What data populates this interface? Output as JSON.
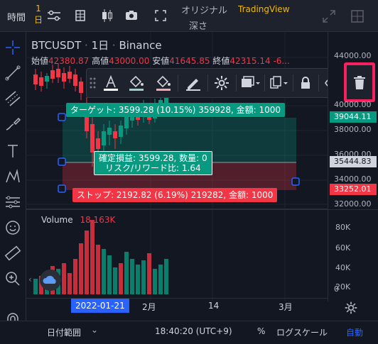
{
  "topbar": {
    "time_label": "時間",
    "interval_label": "1\n日",
    "interval_top": "1",
    "interval_bottom": "日",
    "original_label": "オリジナル",
    "tradingview_label": "TradingView",
    "depth_label": "深さ"
  },
  "chart": {
    "symbol": "BTCUSDT",
    "interval": "1日",
    "exchange": "Binance",
    "open_label": "始値",
    "open_value": "42380.87",
    "high_label": "高値",
    "high_value": "43000.00",
    "low_label": "安値",
    "low_value": "41645.85",
    "close_label": "終値",
    "close_value": "42315.14",
    "change_value": "-6...",
    "volume_label": "Volume",
    "volume_value": "18.163K"
  },
  "position": {
    "target_text": "ターゲット: 3599.28 (10.15%) 359928, 金額: 1000",
    "pnl_line1": "確定損益: 3599.28, 数量: 0",
    "pnl_line2": "リスク/リワード比: 1.64",
    "stop_text": "ストップ: 2192.82 (6.19%) 219282, 金額: 1000"
  },
  "price_scale": {
    "labels": [
      "44000.00",
      "40000.00",
      "38000.00",
      "36000.00",
      "34000.00",
      "32000.00"
    ],
    "target_badge": "39044.11",
    "entry_badge": "35444.83",
    "stop_badge": "33252.01",
    "volume_labels": [
      "80K",
      "60K",
      "40K",
      "20K",
      "0"
    ]
  },
  "time_axis": {
    "highlighted_date": "2022-01-21",
    "labels": [
      "2月",
      "14",
      "3月"
    ]
  },
  "bottombar": {
    "date_range": "日付範囲",
    "time": "18:40:20 (UTC+9)",
    "percent": "%",
    "log_scale": "ログスケール",
    "auto": "自動"
  },
  "colors": {
    "background": "#131722",
    "target_green": "#089981",
    "stop_red": "#f23645",
    "highlight_box": "#f7215f",
    "accent_orange": "#f0b90b"
  }
}
